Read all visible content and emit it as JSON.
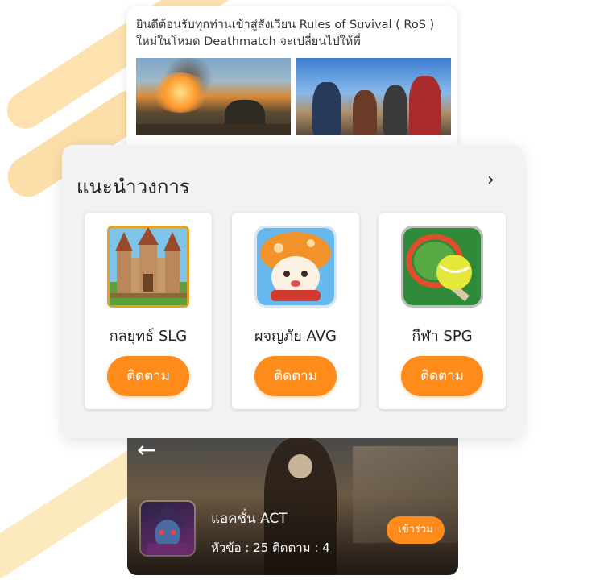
{
  "post": {
    "text": "ยินดีต้อนรับทุกท่านเข้าสู่สังเวียน Rules of Suvival ( RoS ) ใหม่ในโหมด Deathmatch จะเปลี่ยนไปให้พี่"
  },
  "recommend": {
    "title": "แนะนำวงการ",
    "more_icon": "chevron-right-icon",
    "cards": [
      {
        "name": "กลยุทธ์ SLG",
        "button": "ติดตาม",
        "icon": "castle-icon"
      },
      {
        "name": "ผจญภัย AVG",
        "button": "ติดตาม",
        "icon": "mushroom-icon"
      },
      {
        "name": "กีฬา SPG",
        "button": "ติดตาม",
        "icon": "tennis-icon"
      }
    ]
  },
  "banner": {
    "back_icon": "arrow-left-icon",
    "title": "แอคชั่น ACT",
    "stats": "หัวข้อ :  25  ติดตาม :  4",
    "join": "เข้าร่วม"
  },
  "colors": {
    "accent": "#ff8c1a",
    "stripe": "#fcd896"
  }
}
